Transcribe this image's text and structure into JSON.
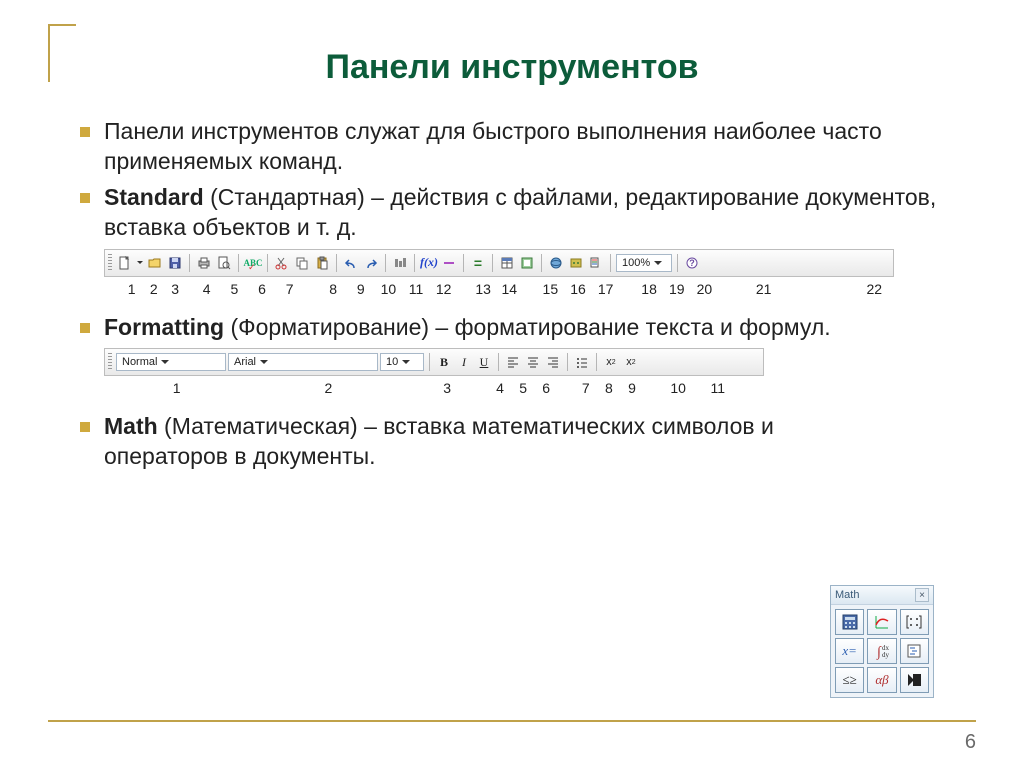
{
  "title": "Панели инструментов",
  "bullets": {
    "b1": "Панели инструментов служат для быстрого выполнения наиболее часто применяемых команд.",
    "b2_bold": "Standard",
    "b2_rest": " (Стандартная)  – действия с файлами, редактирование документов, вставка объектов и т. д.",
    "b3_bold": "Formatting",
    "b3_rest": " (Форматирование)  – форматирование текста и формул.",
    "b4_bold": "Math",
    "b4_rest": " (Математическая)  – вставка математических символов и операторов в документы."
  },
  "standard_toolbar": {
    "zoom": "100%",
    "labels": [
      "1",
      "2",
      "3",
      "4",
      "5",
      "6",
      "7",
      "8",
      "9",
      "10",
      "11",
      "12",
      "13",
      "14",
      "15",
      "16",
      "17",
      "18",
      "19",
      "20",
      "21",
      "22"
    ]
  },
  "formatting_toolbar": {
    "style": "Normal",
    "font": "Arial",
    "size": "10",
    "labels": [
      "1",
      "2",
      "3",
      "4",
      "5",
      "6",
      "7",
      "8",
      "9",
      "10",
      "11"
    ]
  },
  "math_palette": {
    "title": "Math",
    "cells": [
      "calc",
      "graph",
      "matrix",
      "x=",
      "integral",
      "prog",
      "compare",
      "alpha-beta",
      "hat"
    ]
  },
  "page": "6"
}
